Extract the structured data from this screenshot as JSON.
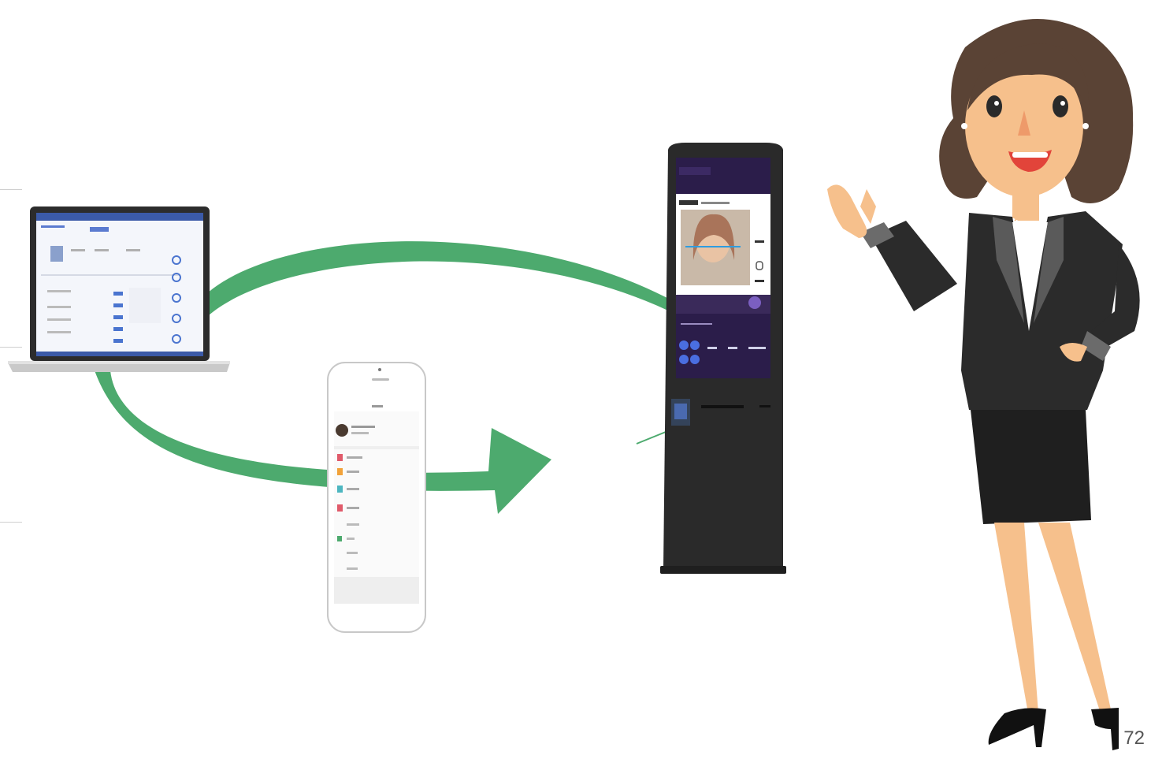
{
  "slide": {
    "page_number": "72"
  },
  "colors": {
    "arrow": "#4daa6e",
    "kiosk_body": "#2a2a2a",
    "kiosk_screen_top": "#2b1d4a",
    "suit": "#2b2b2b",
    "hair": "#5a4335",
    "skin": "#f6c08c"
  },
  "icons": {
    "laptop": "laptop-icon",
    "phone": "smartphone-icon",
    "kiosk": "face-recognition-kiosk-icon",
    "presenter": "businesswoman-presenter-illustration"
  }
}
